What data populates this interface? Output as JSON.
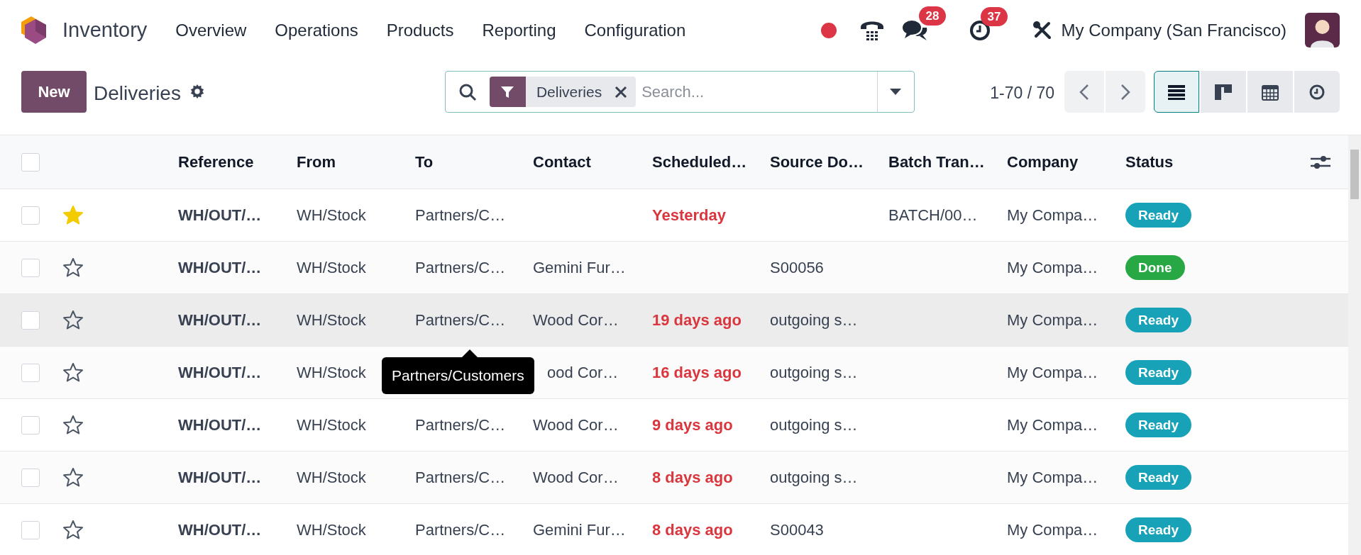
{
  "navbar": {
    "app_name": "Inventory",
    "menu": [
      "Overview",
      "Operations",
      "Products",
      "Reporting",
      "Configuration"
    ],
    "messages_badge": "28",
    "activities_badge": "37",
    "company": "My Company (San Francisco)"
  },
  "control_panel": {
    "new_button": "New",
    "title": "Deliveries",
    "search": {
      "facet": "Deliveries",
      "placeholder": "Search..."
    },
    "pager": "1-70 / 70",
    "views": [
      {
        "kind": "list",
        "selected": true
      },
      {
        "kind": "kanban",
        "selected": false
      },
      {
        "kind": "calendar",
        "selected": false
      },
      {
        "kind": "activity",
        "selected": false
      }
    ]
  },
  "table": {
    "select_all": {
      "checked": false
    },
    "columns": [
      "Reference",
      "From",
      "To",
      "Contact",
      "Scheduled…",
      "Source Do…",
      "Batch Tran…",
      "Company",
      "Status"
    ],
    "rows": [
      {
        "checked": false,
        "starred": true,
        "hovered": false,
        "reference": "WH/OUT/…",
        "from": "WH/Stock",
        "to": "Partners/C…",
        "contact": "",
        "scheduled": {
          "text": "Yesterday",
          "overdue": true
        },
        "source": "",
        "batch": "BATCH/00…",
        "company": "My Compa…",
        "status": "Ready",
        "color": "#17a2b8"
      },
      {
        "checked": false,
        "starred": false,
        "hovered": false,
        "reference": "WH/OUT/…",
        "from": "WH/Stock",
        "to": "Partners/C…",
        "contact": "Gemini Fur…",
        "source": "S00056",
        "batch": "",
        "company": "My Compa…",
        "status": "Done",
        "color": "#28a745"
      },
      {
        "checked": false,
        "starred": false,
        "hovered": true,
        "reference": "WH/OUT/…",
        "from": "WH/Stock",
        "to": "Partners/C…",
        "contact": "Wood Cor…",
        "scheduled": {
          "text": "19 days ago",
          "overdue": true
        },
        "source": "outgoing s…",
        "batch": "",
        "company": "My Compa…",
        "status": "Ready",
        "color": "#17a2b8"
      },
      {
        "checked": false,
        "starred": false,
        "hovered": false,
        "reference": "WH/OUT/…",
        "from": "WH/Stock",
        "to": "",
        "contact": "ood Cor…",
        "scheduled": {
          "text": "16 days ago",
          "overdue": true
        },
        "source": "outgoing s…",
        "batch": "",
        "company": "My Compa…",
        "status": "Ready",
        "color": "#17a2b8"
      },
      {
        "checked": false,
        "starred": false,
        "hovered": false,
        "reference": "WH/OUT/…",
        "from": "WH/Stock",
        "to": "Partners/C…",
        "contact": "Wood Cor…",
        "scheduled": {
          "text": "9 days ago",
          "overdue": true
        },
        "source": "outgoing s…",
        "batch": "",
        "company": "My Compa…",
        "status": "Ready",
        "color": "#17a2b8"
      },
      {
        "checked": false,
        "starred": false,
        "hovered": false,
        "reference": "WH/OUT/…",
        "from": "WH/Stock",
        "to": "Partners/C…",
        "contact": "Wood Cor…",
        "scheduled": {
          "text": "8 days ago",
          "overdue": true
        },
        "source": "outgoing s…",
        "batch": "",
        "company": "My Compa…",
        "status": "Ready",
        "color": "#17a2b8"
      },
      {
        "checked": false,
        "starred": false,
        "hovered": false,
        "reference": "WH/OUT/…",
        "from": "WH/Stock",
        "to": "Partners/C…",
        "contact": "Gemini Fur…",
        "scheduled": {
          "text": "8 days ago",
          "overdue": true
        },
        "source": "S00043",
        "batch": "",
        "company": "My Compa…",
        "status": "Ready",
        "color": "#17a2b8"
      }
    ]
  },
  "tooltip": "Partners/Customers"
}
